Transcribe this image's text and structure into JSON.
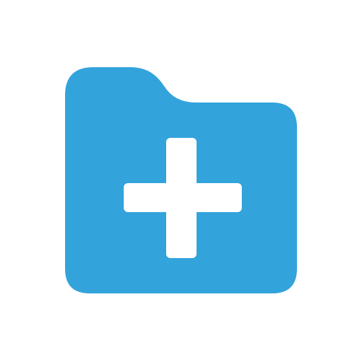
{
  "icon": {
    "name": "folder-add-icon",
    "folder_color": "#33A3DC",
    "plus_color": "#FFFFFF",
    "background_color": "#FFFFFF"
  }
}
